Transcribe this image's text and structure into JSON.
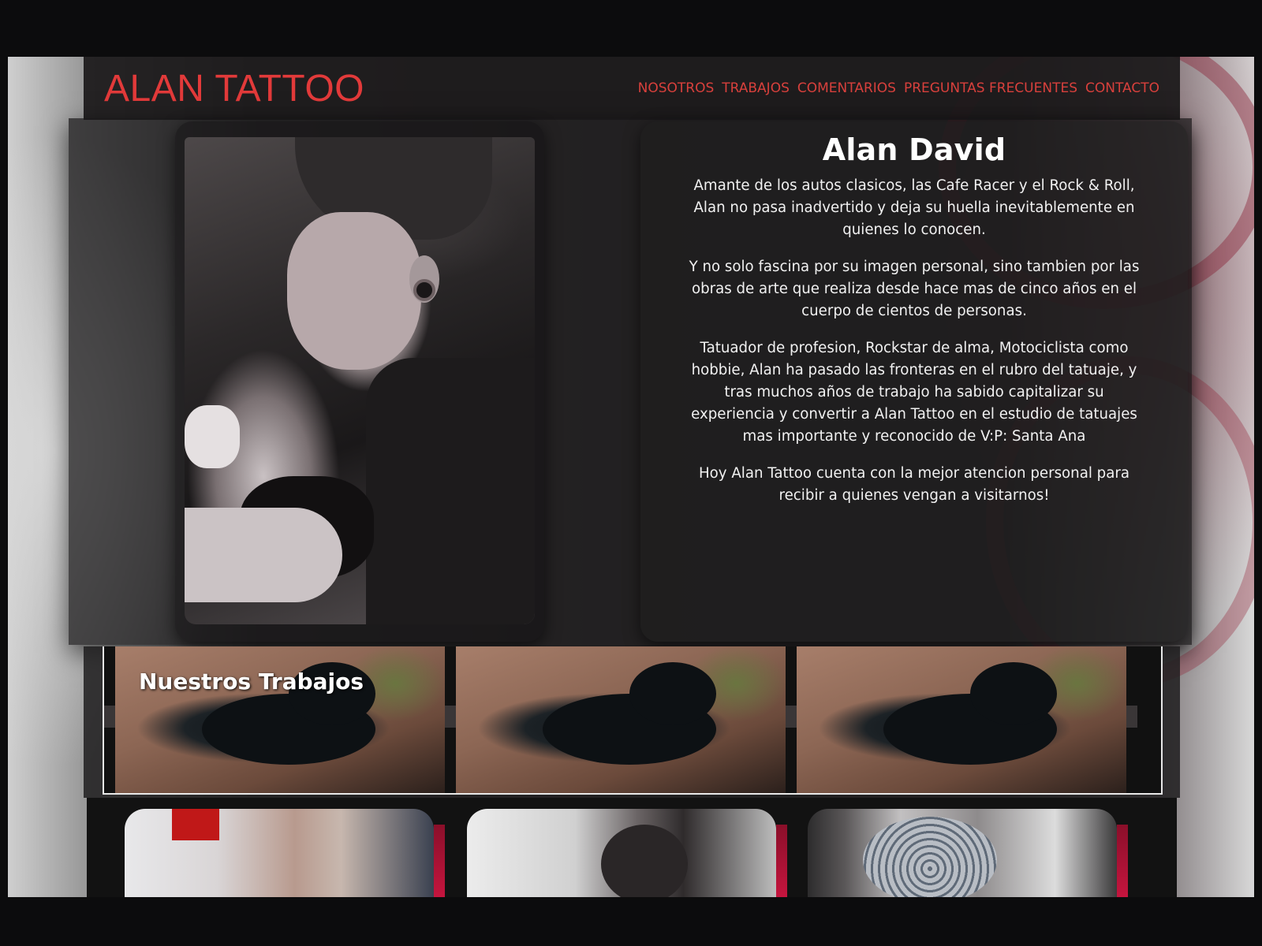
{
  "site": {
    "logo": "ALAN TATTOO",
    "nav": [
      "NOSOTROS",
      "TRABAJOS",
      "COMENTARIOS",
      "PREGUNTAS FRECUENTES",
      "CONTACTO"
    ],
    "accent_color": "#e23a3a"
  },
  "about": {
    "name": "Alan David",
    "paragraphs": [
      "Amante de los autos clasicos, las Cafe Racer y el Rock & Roll, Alan no pasa inadvertido y deja su huella inevitablemente en quienes lo conocen.",
      "Y no solo fascina por su imagen personal, sino tambien por las obras de arte que realiza desde hace mas de cinco años en el cuerpo de cientos de personas.",
      "Tatuador de profesion, Rockstar de alma, Motociclista como hobbie, Alan ha pasado las fronteras en el rubro del tatuaje, y tras muchos años de trabajo ha sabido capitalizar su experiencia y convertir a Alan Tattoo en el estudio de tatuajes mas importante y reconocido de V:P: Santa Ana",
      "Hoy Alan Tattoo cuenta con la mejor atencion personal para recibir a quienes vengan a visitarnos!"
    ]
  },
  "carousel": {
    "title": "Nuestros Trabajos"
  }
}
